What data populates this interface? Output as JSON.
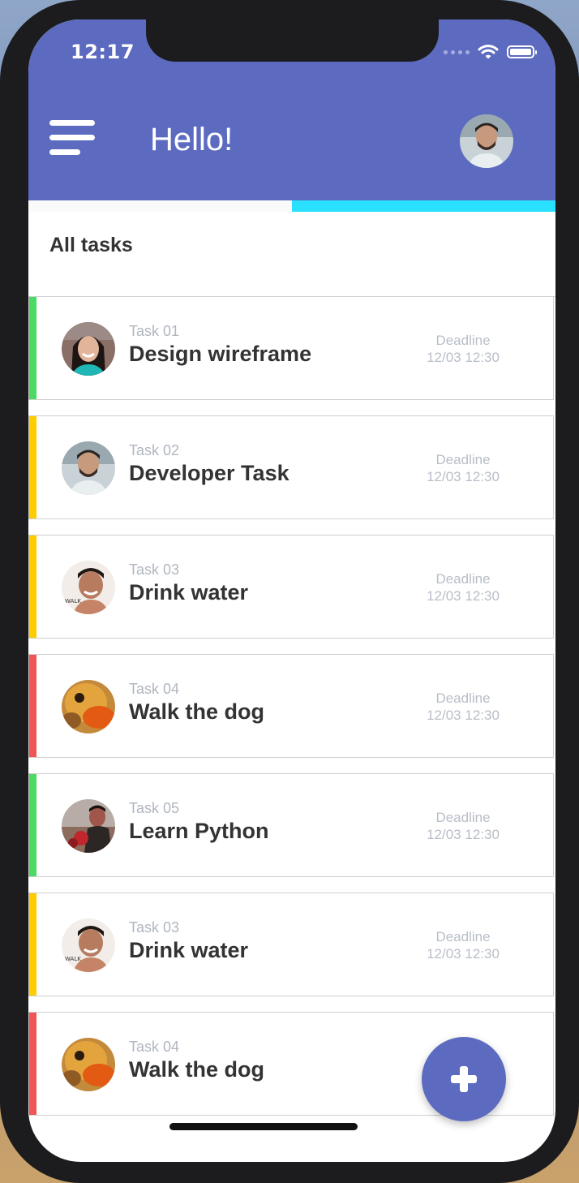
{
  "status_bar": {
    "time": "12:17"
  },
  "header": {
    "greeting": "Hello!"
  },
  "progress": {
    "value": 0.5,
    "color": "#29e0ff"
  },
  "section": {
    "title": "All tasks"
  },
  "tasks": [
    {
      "number": "Task 01",
      "title": "Design wireframe",
      "deadline_label": "Deadline",
      "deadline": "12/03 12:30",
      "accent": "#4cd964"
    },
    {
      "number": "Task 02",
      "title": "Developer Task",
      "deadline_label": "Deadline",
      "deadline": "12/03 12:30",
      "accent": "#ffcc00"
    },
    {
      "number": "Task 03",
      "title": "Drink water",
      "deadline_label": "Deadline",
      "deadline": "12/03 12:30",
      "accent": "#ffcc00"
    },
    {
      "number": "Task 04",
      "title": "Walk the dog",
      "deadline_label": "Deadline",
      "deadline": "12/03 12:30",
      "accent": "#f05656"
    },
    {
      "number": "Task 05",
      "title": "Learn Python",
      "deadline_label": "Deadline",
      "deadline": "12/03 12:30",
      "accent": "#4cd964"
    },
    {
      "number": "Task 03",
      "title": "Drink water",
      "deadline_label": "Deadline",
      "deadline": "12/03 12:30",
      "accent": "#ffcc00"
    },
    {
      "number": "Task 04",
      "title": "Walk the dog",
      "deadline_label": "Deadline",
      "deadline": "12/03 12:30",
      "accent": "#f05656"
    }
  ],
  "colors": {
    "primary": "#5c6bc0",
    "green": "#4cd964",
    "yellow": "#ffcc00",
    "red": "#f05656"
  },
  "icons": {
    "menu": "hamburger-menu-icon",
    "add": "plus-icon",
    "wifi": "wifi-icon",
    "battery": "battery-icon"
  }
}
